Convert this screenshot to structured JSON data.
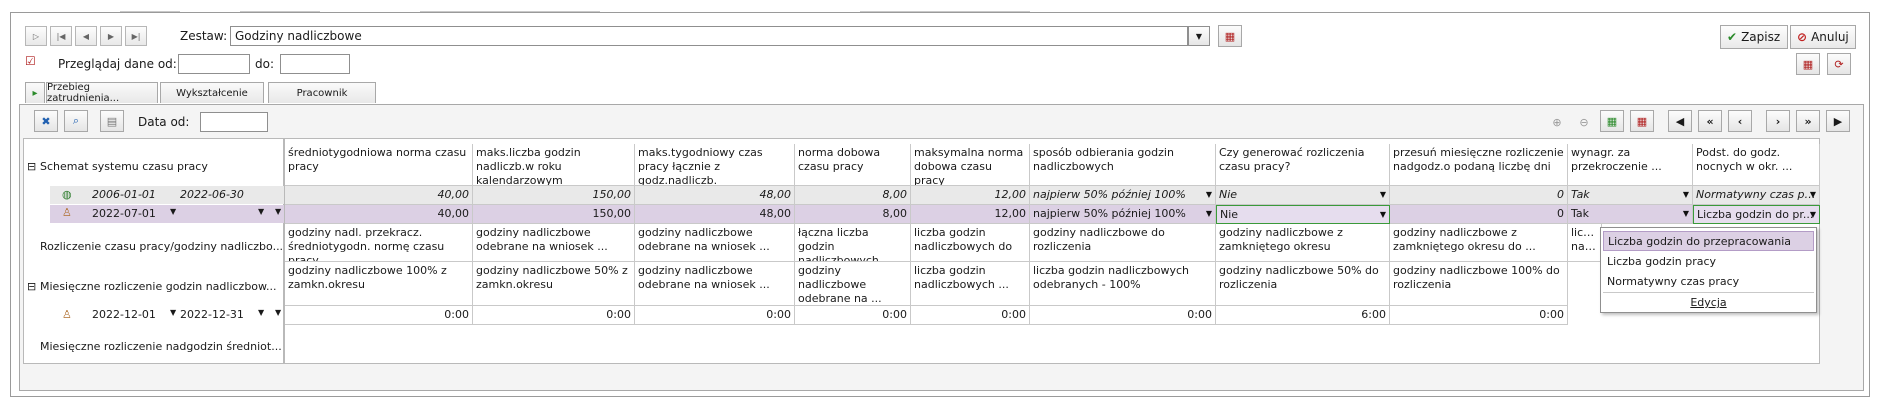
{
  "toolbar": {
    "zestaw_label": "Zestaw:",
    "zestaw_value": "Godziny nadliczbowe",
    "save_label": "Zapisz",
    "cancel_label": "Anuluj"
  },
  "filter": {
    "przegladaj_label": "Przeglądaj dane od:",
    "do_label": "do:",
    "od_value": "",
    "do_value": ""
  },
  "tabs": [
    {
      "label": "Przebieg zatrudnienia..."
    },
    {
      "label": "Wykształcenie"
    },
    {
      "label": "Pracownik"
    }
  ],
  "panel": {
    "data_od_label": "Data od:",
    "data_od_value": ""
  },
  "tree": {
    "section1": "Schemat systemu czasu pracy",
    "row1": {
      "from": "2006-01-01",
      "to": "2022-06-30"
    },
    "row2": {
      "from": "2022-07-01",
      "to": ""
    },
    "section2": "Rozliczenie czasu pracy/godziny nadliczbo...",
    "section3": "Miesięczne rozliczenie godzin nadliczbow...",
    "row3": {
      "from": "2022-12-01",
      "to": "2022-12-31"
    },
    "section4": "Miesięczne rozliczenie nadgodzin średniot..."
  },
  "header1": [
    "średniotygodniowa norma czasu pracy",
    "maks.liczba godzin nadliczb.w roku kalendarzowym",
    "maks.tygodniowy czas pracy łącznie z godz.nadliczb.",
    "norma dobowa czasu pracy",
    "maksymalna norma dobowa czasu pracy",
    "sposób odbierania godzin nadliczbowych",
    "Czy generować rozliczenia czasu pracy?",
    "przesuń miesięczne rozliczenie nadgodz.o podaną liczbę dni",
    "wynagr. za przekroczenie ...",
    "Podst. do godz. nocnych w okr. ..."
  ],
  "row1": [
    "40,00",
    "150,00",
    "48,00",
    "8,00",
    "12,00",
    "najpierw 50% później 100%",
    "Nie",
    "0",
    "Tak",
    "Normatywny czas pr..."
  ],
  "row2": [
    "40,00",
    "150,00",
    "48,00",
    "8,00",
    "12,00",
    "najpierw 50% później 100%",
    "Nie",
    "0",
    "Tak",
    "Liczba godzin do pr..."
  ],
  "header2": [
    "godziny nadl. przekracz. średniotygodn. normę czasu pracy",
    "godziny nadliczbowe odebrane na wniosek ...",
    "godziny nadliczbowe odebrane na wniosek ...",
    "łączna liczba godzin nadliczbowych ...",
    "liczba godzin nadliczbowych do ...",
    "godziny nadliczbowe do rozliczenia",
    "godziny nadliczbowe z zamkniętego okresu",
    "godziny nadliczbowe z zamkniętego okresu do ...",
    "liczba nadlic..."
  ],
  "header3": [
    "godziny nadliczbowe 100% z zamkn.okresu",
    "godziny nadliczbowe 50% z zamkn.okresu",
    "godziny nadliczbowe odebrane na wniosek ...",
    "godziny nadliczbowe odebrane na ...",
    "liczba godzin nadliczbowych ...",
    "liczba godzin nadliczbowych odebranych - 100%",
    "godziny nadliczbowe 50% do rozliczenia",
    "godziny nadliczbowe 100% do rozliczenia"
  ],
  "row3": [
    "0:00",
    "0:00",
    "0:00",
    "0:00",
    "0:00",
    "0:00",
    "6:00",
    "0:00"
  ],
  "dropdown": {
    "items": [
      "Liczba godzin do przepracowania",
      "Liczba godzin pracy",
      "Normatywny czas pracy"
    ],
    "edit_label": "Edycja"
  },
  "colors": {
    "accent_row": "#dcd0e4",
    "selected_border": "#3a9a3a"
  }
}
